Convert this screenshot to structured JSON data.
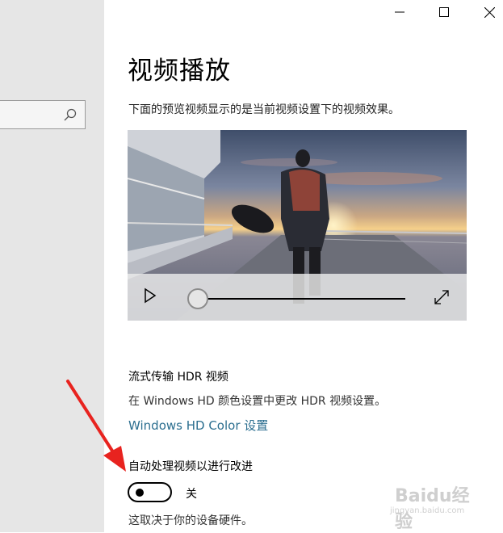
{
  "window": {
    "minimize_glyph": "—",
    "maximize_glyph": "☐",
    "close_glyph": "✕"
  },
  "sidebar": {
    "search": {
      "placeholder": "",
      "icon": "search-icon"
    }
  },
  "page": {
    "title": "视频播放",
    "preview_description": "下面的预览视频显示的是当前视频设置下的视频效果。"
  },
  "video_player": {
    "play_icon": "play-icon",
    "fullscreen_icon": "fullscreen-icon",
    "progress": 0.0
  },
  "hdr_section": {
    "heading": "流式传输 HDR 视频",
    "description": "在 Windows HD 颜色设置中更改 HDR 视频设置。",
    "link": "Windows HD Color 设置"
  },
  "auto_process_section": {
    "heading": "自动处理视频以进行改进",
    "toggle_state": "关",
    "toggle_on": false,
    "note": "这取决于你的设备硬件。"
  },
  "watermark": {
    "text": "Baidu经验",
    "subtext": "jingyan.baidu.com"
  },
  "colors": {
    "sidebar_bg": "#e6e6e6",
    "link": "#2b6e8f",
    "arrow": "#e8231f"
  }
}
